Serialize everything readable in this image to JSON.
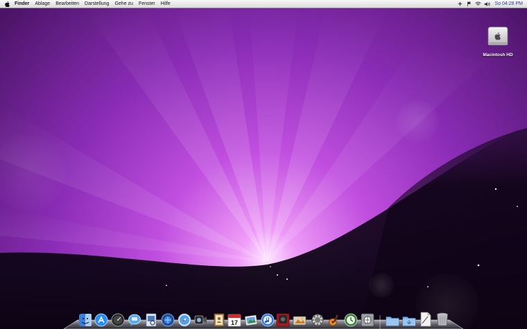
{
  "menubar": {
    "apple_icon": "apple-icon",
    "items": [
      "Finder",
      "Ablage",
      "Bearbeiten",
      "Darstellung",
      "Gehe zu",
      "Fenster",
      "Hilfe"
    ],
    "status_icons": [
      "plus-icon",
      "flag-icon",
      "wifi-icon",
      "volume-icon"
    ],
    "clock": "So 04:28 PM"
  },
  "desktop": {
    "hd_label": "Macintosh HD"
  },
  "dock": {
    "apps": [
      "finder-icon",
      "app-store-icon",
      "dashboard-icon",
      "ichat-icon",
      "preview-icon",
      "iweb-icon",
      "safari-icon",
      "facetime-icon",
      "address-book-icon",
      "ical-icon",
      "iphoto-icon",
      "itunes-icon",
      "photo-booth-icon",
      "iphoto-icon",
      "system-preferences-icon",
      "garageband-icon",
      "time-machine-icon",
      "network-icon",
      "folder-icon",
      "downloads-icon",
      "document-icon",
      "trash-icon"
    ],
    "calendar_day": "17"
  },
  "colors": {
    "wallpaper_core": "#f3a8ff",
    "wallpaper_mid": "#a03fd0",
    "wallpaper_edge": "#3a1150",
    "menubar": "#e8e8e8",
    "clock_text": "#2b3c8f"
  }
}
